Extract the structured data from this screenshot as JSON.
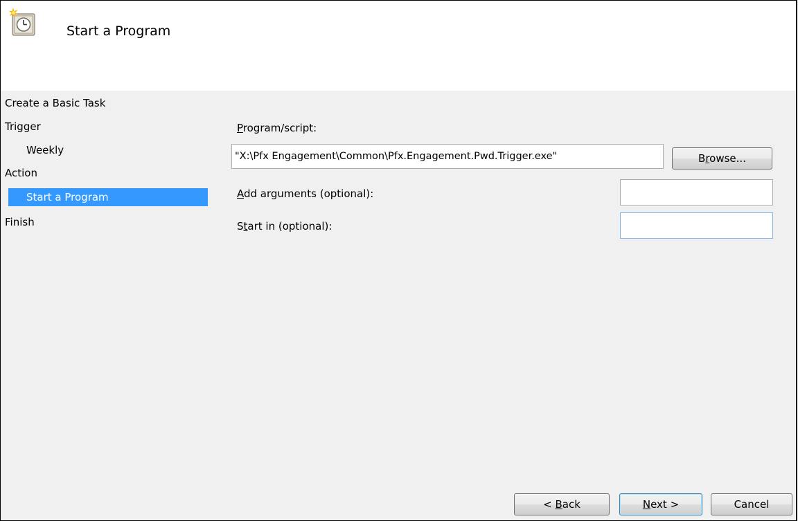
{
  "header": {
    "title": "Start a Program",
    "icon": "scheduled-task-clock-icon"
  },
  "steps": [
    {
      "label": "Create a Basic Task",
      "level": 0,
      "selected": false
    },
    {
      "label": "Trigger",
      "level": 0,
      "selected": false
    },
    {
      "label": "Weekly",
      "level": 1,
      "selected": false
    },
    {
      "label": "Action",
      "level": 0,
      "selected": false
    },
    {
      "label": "Start a Program",
      "level": 1,
      "selected": true
    },
    {
      "label": "Finish",
      "level": 0,
      "selected": false
    }
  ],
  "form": {
    "program_label": {
      "mnemonic": "P",
      "rest": "rogram/script:"
    },
    "program_value": "\"X:\\Pfx Engagement\\Common\\Pfx.Engagement.Pwd.Trigger.exe\"",
    "browse_label": {
      "pre": "B",
      "mnemonic": "r",
      "rest": "owse..."
    },
    "arguments_label": {
      "mnemonic": "A",
      "rest": "dd arguments (optional):"
    },
    "arguments_value": "",
    "startin_label": {
      "pre": "S",
      "mnemonic": "t",
      "rest": "art in (optional):"
    },
    "startin_value": ""
  },
  "buttons": {
    "back": {
      "pre": "< ",
      "mnemonic": "B",
      "rest": "ack"
    },
    "next": {
      "pre": "",
      "mnemonic": "N",
      "rest": "ext >"
    },
    "cancel": "Cancel"
  },
  "colors": {
    "selection": "#3399ff",
    "panel": "#f0f0f0",
    "header": "#ffffff"
  }
}
